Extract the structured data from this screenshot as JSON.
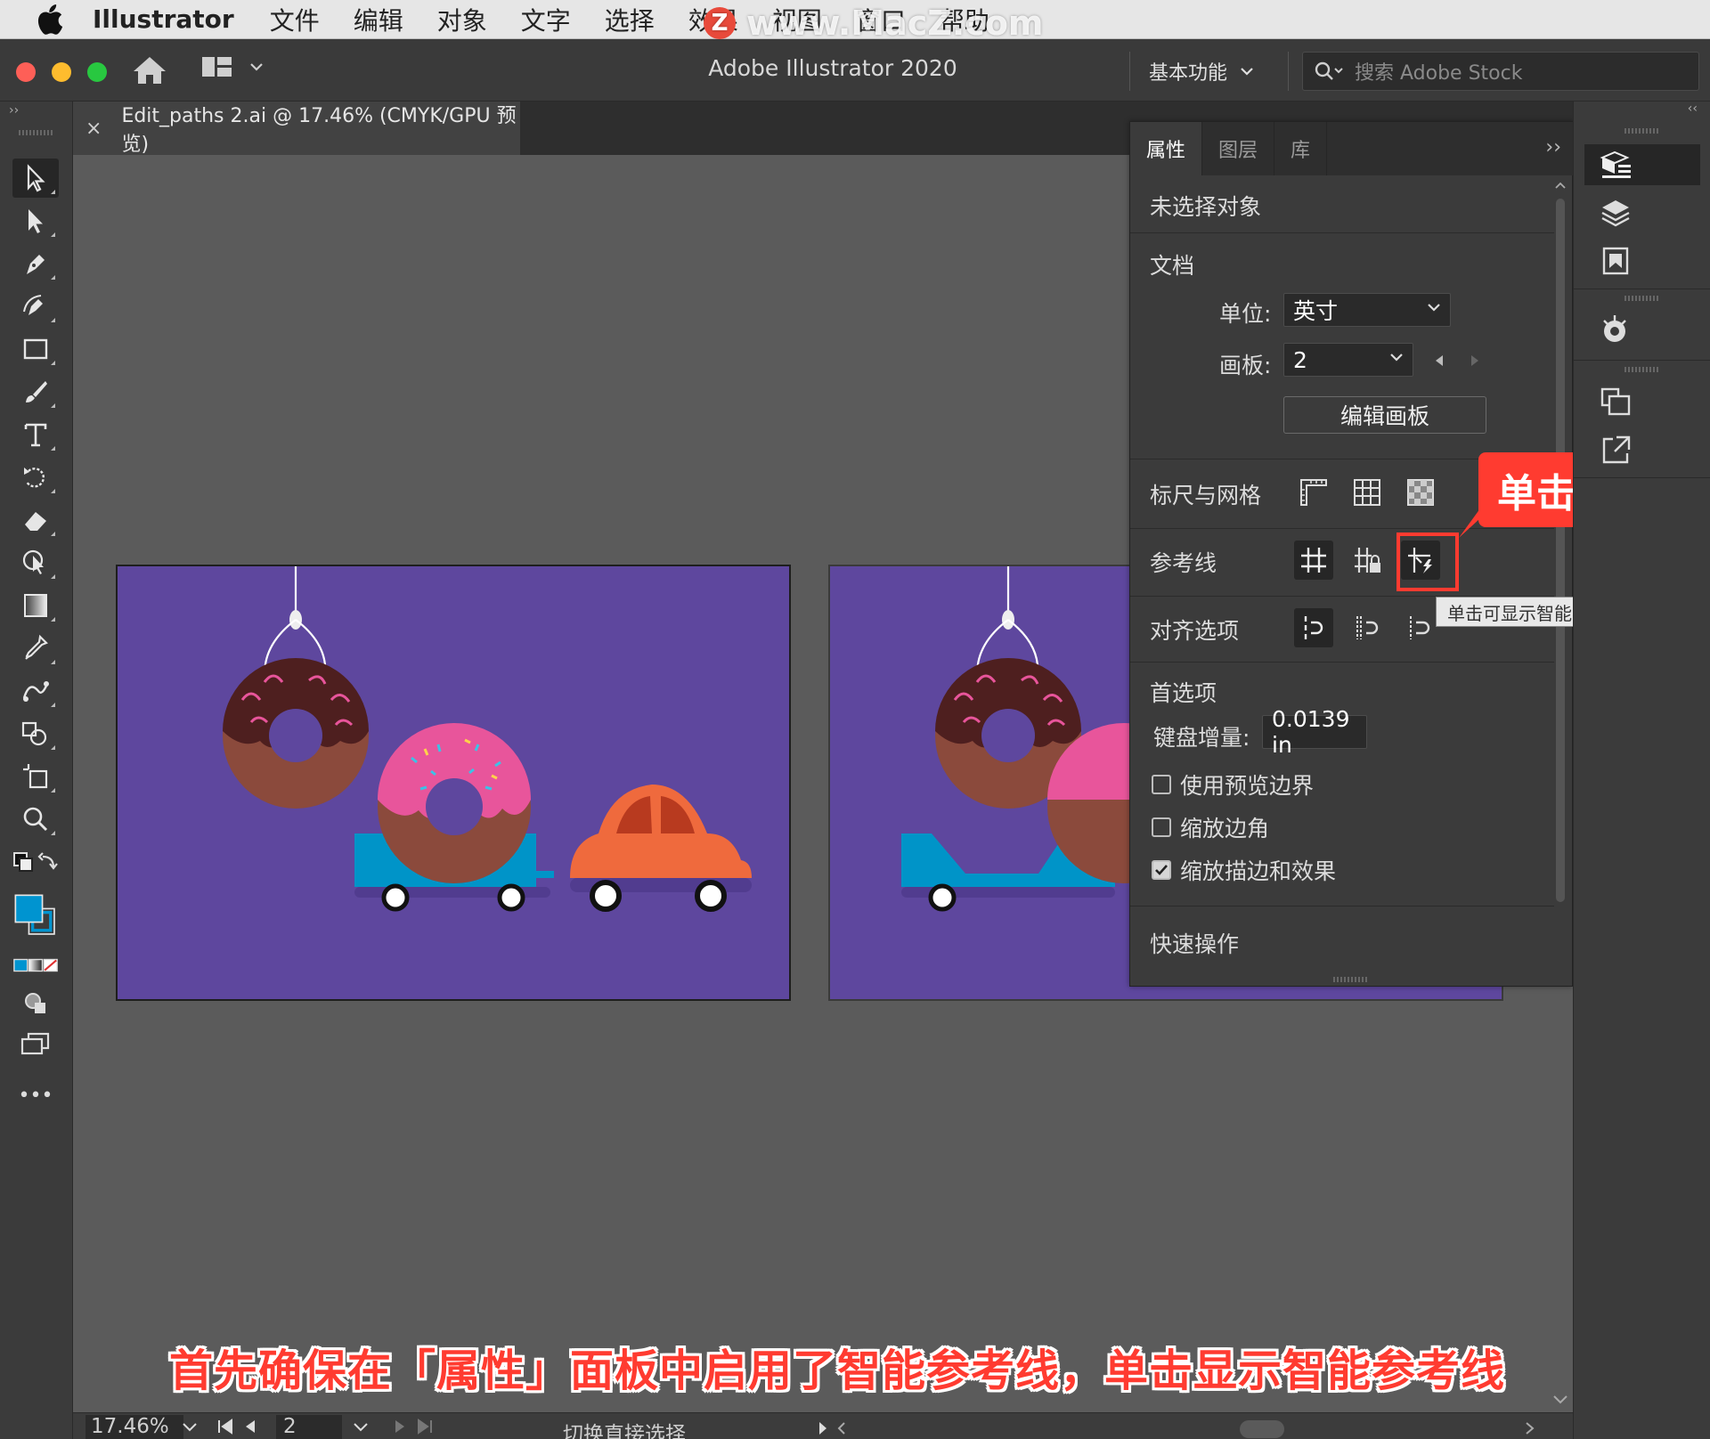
{
  "menubar": {
    "app_name": "Illustrator",
    "items": [
      "文件",
      "编辑",
      "对象",
      "文字",
      "选择",
      "效果",
      "视图",
      "窗口",
      "帮助"
    ],
    "watermark": "www.MacZ.com",
    "watermark_logo": "Z"
  },
  "titlebar": {
    "title": "Adobe Illustrator 2020",
    "workspace": "基本功能",
    "stock_placeholder": "搜索 Adobe Stock"
  },
  "toolbar": {
    "collapse": "››",
    "tools": [
      "selection-tool",
      "direct-selection-tool",
      "pen-tool",
      "curvature-tool",
      "rectangle-tool",
      "paintbrush-tool",
      "type-tool",
      "rotate-tool",
      "eraser-tool",
      "puppet-warp-tool",
      "gradient-tool",
      "eyedropper-tool",
      "blend-tool",
      "shape-builder-tool",
      "artboard-tool",
      "zoom-tool"
    ],
    "more": "•••"
  },
  "document": {
    "tab_label": "Edit_paths 2.ai @ 17.46% (CMYK/GPU 预览)",
    "close": "×"
  },
  "panel": {
    "tabs": [
      "属性",
      "图层",
      "库"
    ],
    "more": "››",
    "no_selection": "未选择对象",
    "document_section": "文档",
    "units_label": "单位:",
    "units_value": "英寸",
    "artboard_label": "画板:",
    "artboard_value": "2",
    "edit_artboards": "编辑画板",
    "rulers_grids": "标尺与网格",
    "guides": "参考线",
    "align_options": "对齐选项",
    "preferences": "首选项",
    "keyboard_increment_label": "键盘增量:",
    "keyboard_increment_value": "0.0139 in",
    "use_preview_bounds": "使用预览边界",
    "scale_corners": "缩放边角",
    "scale_strokes": "缩放描边和效果",
    "use_preview_bounds_checked": false,
    "scale_corners_checked": false,
    "scale_strokes_checked": true,
    "quick_actions": "快速操作"
  },
  "annotation": {
    "callout": "单击",
    "tooltip": "单击可显示智能参考线",
    "caption": "首先确保在「属性」面板中启用了智能参考线，单击显示智能参考线"
  },
  "statusbar": {
    "zoom": "17.46%",
    "artboard": "2",
    "status": "切换直接选择"
  },
  "dock": {
    "collapse": "‹‹"
  },
  "colors": {
    "accent": "#ff3b30",
    "artboard_bg": "#5e479e",
    "donut_dough": "#8b4a3c",
    "chocolate": "#4e1f1f",
    "pink_icing": "#e8559b",
    "trailer": "#0094c8",
    "car": "#ef6a3d",
    "fill_swatch": "#0094d0"
  }
}
